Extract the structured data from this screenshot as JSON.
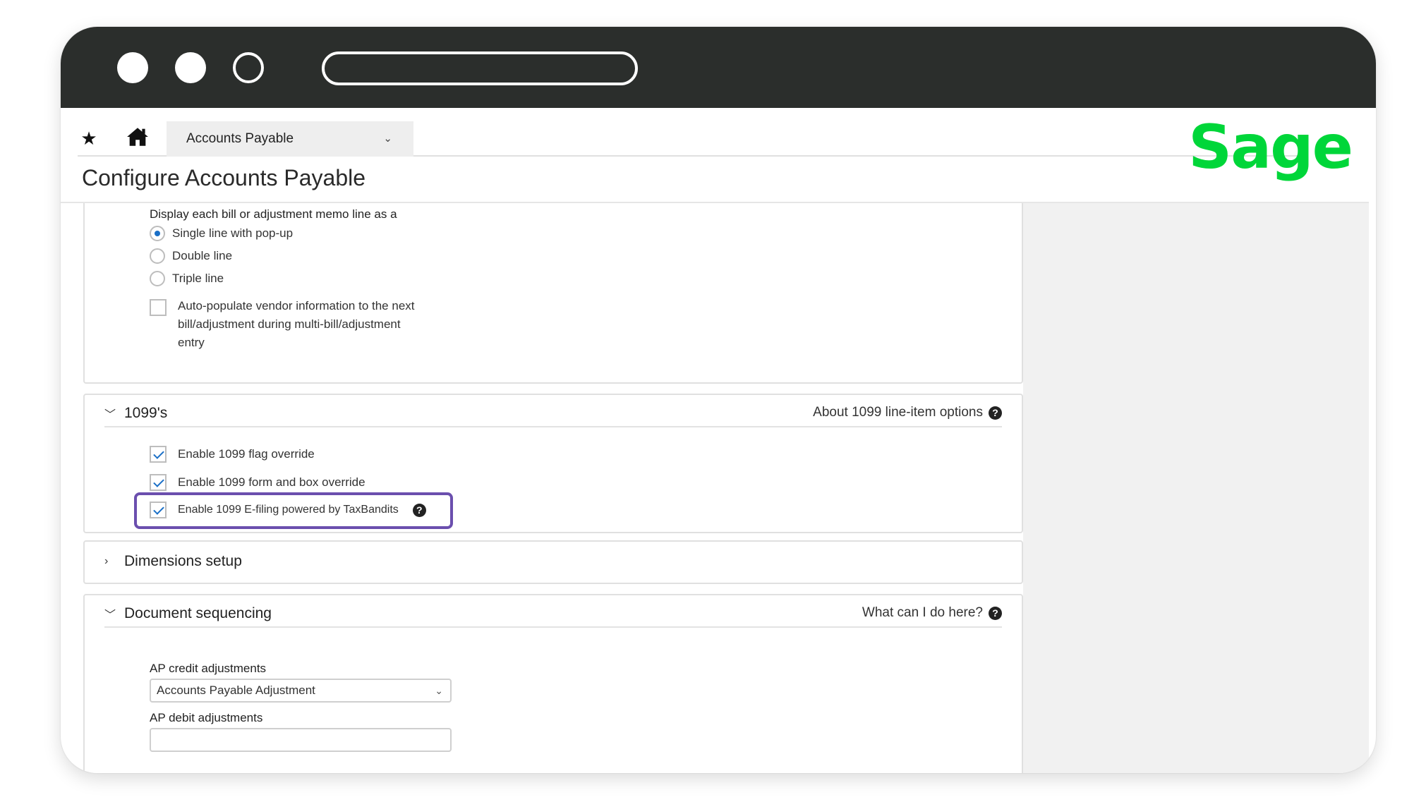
{
  "nav": {
    "module": "Accounts Payable"
  },
  "logo": "Sage",
  "page_title": "Configure Accounts Payable",
  "memo_section": {
    "display_label": "Display each bill or adjustment memo line as a",
    "options": [
      "Single line with pop-up",
      "Double line",
      "Triple line"
    ],
    "selected": "Single line with pop-up",
    "auto_populate": {
      "lines": [
        "Auto-populate vendor information to the next",
        "bill/adjustment during multi-bill/adjustment",
        "entry"
      ],
      "checked": false
    }
  },
  "section_1099": {
    "title": "1099's",
    "help": "About 1099 line-item options",
    "options": [
      {
        "label": "Enable 1099 flag override",
        "checked": true
      },
      {
        "label": "Enable 1099 form and box override",
        "checked": true
      },
      {
        "label": "Enable 1099 E-filing powered by TaxBandits",
        "checked": true
      }
    ]
  },
  "dimensions": {
    "title": "Dimensions setup"
  },
  "doc_seq": {
    "title": "Document sequencing",
    "help": "What can I do here?",
    "credit_label": "AP credit adjustments",
    "credit_value": "Accounts Payable Adjustment",
    "debit_label": "AP debit adjustments"
  },
  "colors": {
    "chrome": "#2b2e2c",
    "brand_green": "#00d639",
    "highlight": "#6b4fae",
    "check_blue": "#1a6fc7"
  }
}
